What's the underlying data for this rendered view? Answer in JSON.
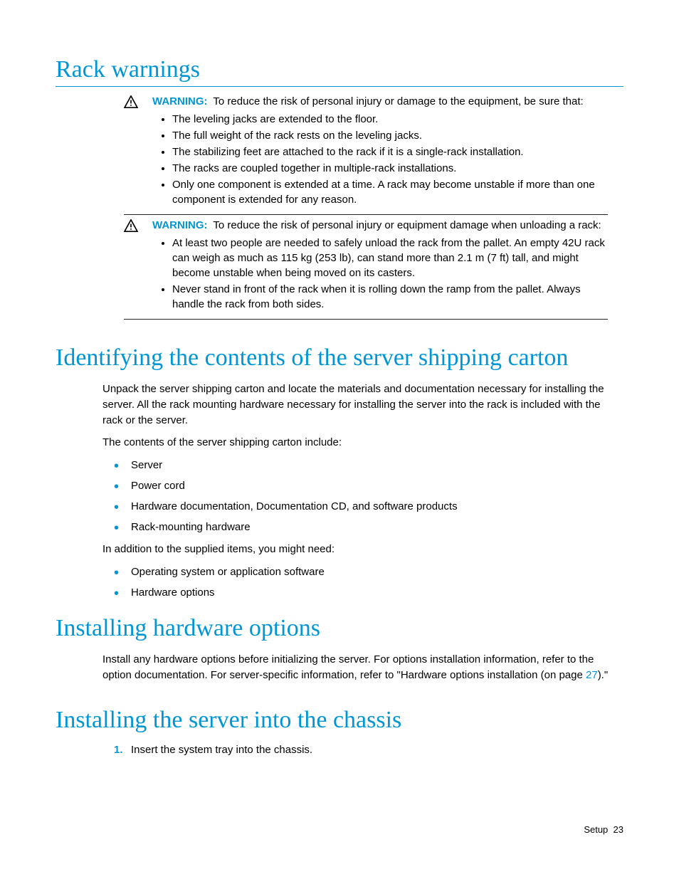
{
  "sections": {
    "rack_warnings": {
      "title": "Rack warnings",
      "warning1": {
        "label": "WARNING:",
        "intro": "To reduce the risk of personal injury or damage to the equipment, be sure that:",
        "items": [
          "The leveling jacks are extended to the floor.",
          "The full weight of the rack rests on the leveling jacks.",
          "The stabilizing feet are attached to the rack if it is a single-rack installation.",
          "The racks are coupled together in multiple-rack installations.",
          "Only one component is extended at a time. A rack may become unstable if more than one component is extended for any reason."
        ]
      },
      "warning2": {
        "label": "WARNING:",
        "intro": "To reduce the risk of personal injury or equipment damage when unloading a rack:",
        "items": [
          "At least two people are needed to safely unload the rack from the pallet. An empty 42U rack can weigh as much as 115 kg (253 lb), can stand more than 2.1 m (7 ft) tall, and might become unstable when being moved on its casters.",
          "Never stand in front of the rack when it is rolling down the ramp from the pallet. Always handle the rack from both sides."
        ]
      }
    },
    "identifying": {
      "title": "Identifying the contents of the server shipping carton",
      "p1": "Unpack the server shipping carton and locate the materials and documentation necessary for installing the server. All the rack mounting hardware necessary for installing the server into the rack is included with the rack or the server.",
      "p2": "The contents of the server shipping carton include:",
      "list1": [
        "Server",
        "Power cord",
        "Hardware documentation, Documentation CD, and software products",
        "Rack-mounting hardware"
      ],
      "p3": "In addition to the supplied items, you might need:",
      "list2": [
        "Operating system or application software",
        "Hardware options"
      ]
    },
    "installing_hw": {
      "title": "Installing hardware options",
      "p1_pre": "Install any hardware options before initializing the server. For options installation information, refer to the option documentation. For server-specific information, refer to \"Hardware options installation (on page ",
      "p1_link": "27",
      "p1_post": ").\""
    },
    "installing_chassis": {
      "title": "Installing the server into the chassis",
      "step1_num": "1.",
      "step1": "Insert the system tray into the chassis."
    }
  },
  "footer": {
    "section": "Setup",
    "page": "23"
  }
}
